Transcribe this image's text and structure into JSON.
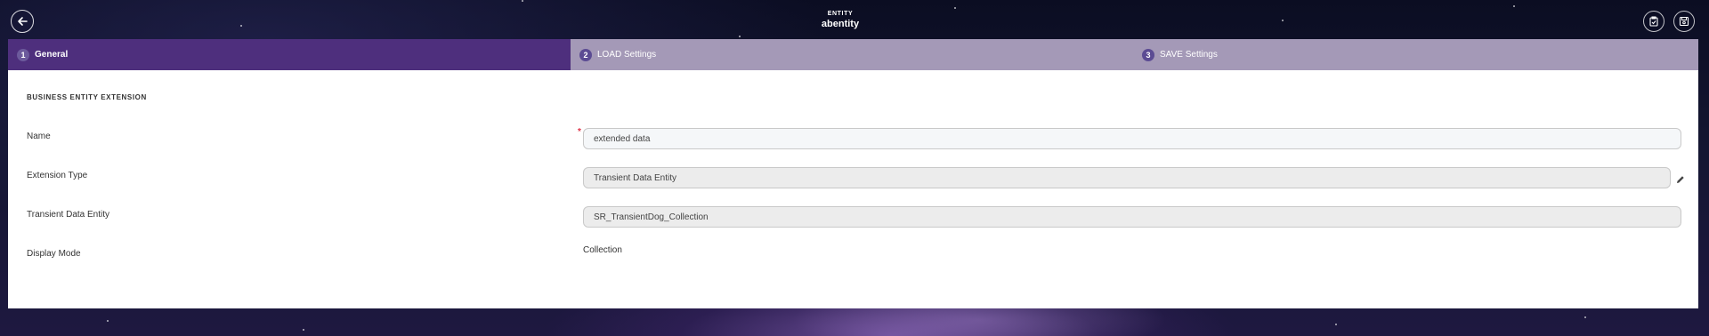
{
  "header": {
    "back_icon": "arrow-left-icon",
    "subtitle": "ENTITY",
    "title": "abentity",
    "actions": [
      {
        "icon": "clipboard-check-icon"
      },
      {
        "icon": "save-icon"
      }
    ]
  },
  "steps": [
    {
      "number": "1",
      "label": "General",
      "active": true
    },
    {
      "number": "2",
      "label": "LOAD Settings",
      "active": false
    },
    {
      "number": "3",
      "label": "SAVE Settings",
      "active": false
    }
  ],
  "section": {
    "title": "BUSINESS ENTITY EXTENSION"
  },
  "form": {
    "name": {
      "label": "Name",
      "value": "extended data",
      "required_mark": "*"
    },
    "extension_type": {
      "label": "Extension Type",
      "value": "Transient Data Entity"
    },
    "transient_data_entity": {
      "label": "Transient Data Entity",
      "value": "SR_TransientDog_Collection"
    },
    "display_mode": {
      "label": "Display Mode",
      "value": "Collection"
    }
  },
  "colors": {
    "active_step": "#4e2f7d",
    "inactive_step": "#a499b7",
    "required": "#e0344a"
  }
}
